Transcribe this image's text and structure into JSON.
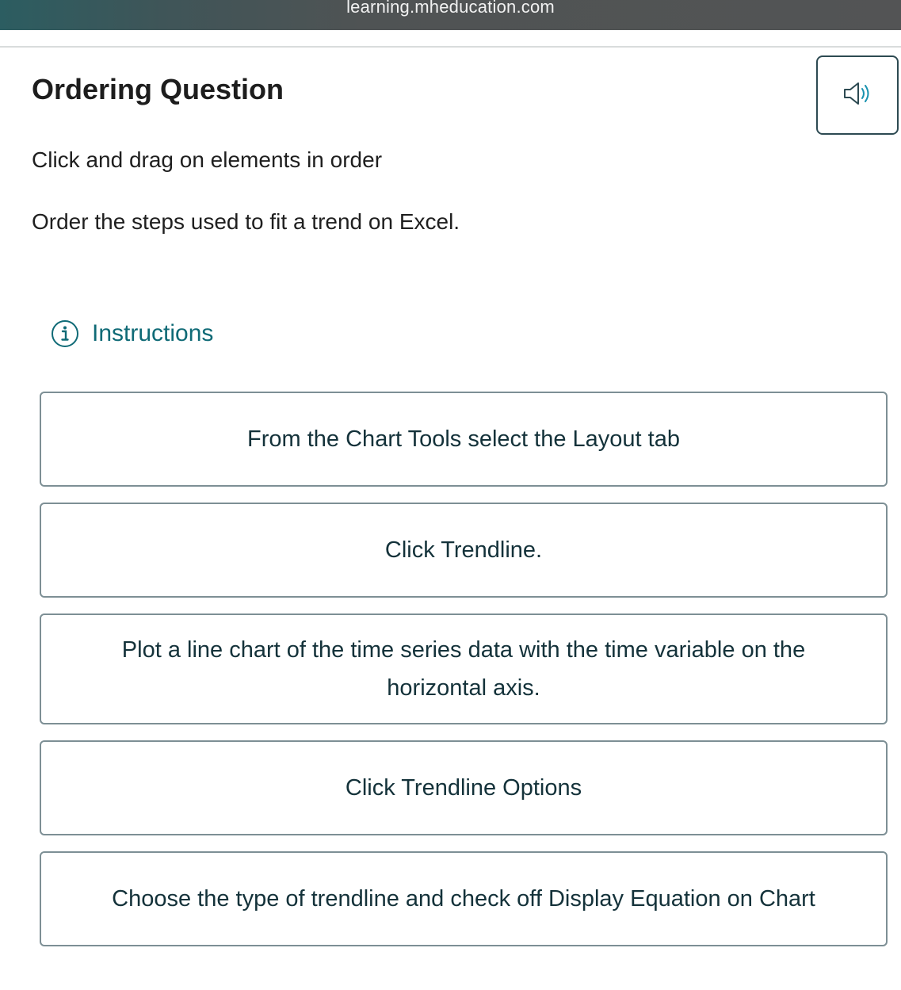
{
  "browser": {
    "url": "learning.mheducation.com"
  },
  "header": {
    "title": "Ordering Question",
    "audio_icon": "speaker-icon"
  },
  "prompt": {
    "instruction": "Click and drag on elements in order",
    "question": "Order the steps used to fit a trend on Excel."
  },
  "instructions_link": {
    "icon": "info-icon",
    "label": "Instructions"
  },
  "items": [
    {
      "label": "From the Chart Tools select the Layout tab"
    },
    {
      "label": "Click Trendline."
    },
    {
      "label": "Plot a line chart of the time series data with the time variable on the horizontal axis."
    },
    {
      "label": "Click Trendline Options"
    },
    {
      "label": "Choose the type of trendline and check off Display Equation on Chart"
    }
  ],
  "colors": {
    "accent": "#0f6a76",
    "item_text": "#14323a",
    "item_border": "#7d8f95",
    "audio_border": "#2d4a52"
  }
}
